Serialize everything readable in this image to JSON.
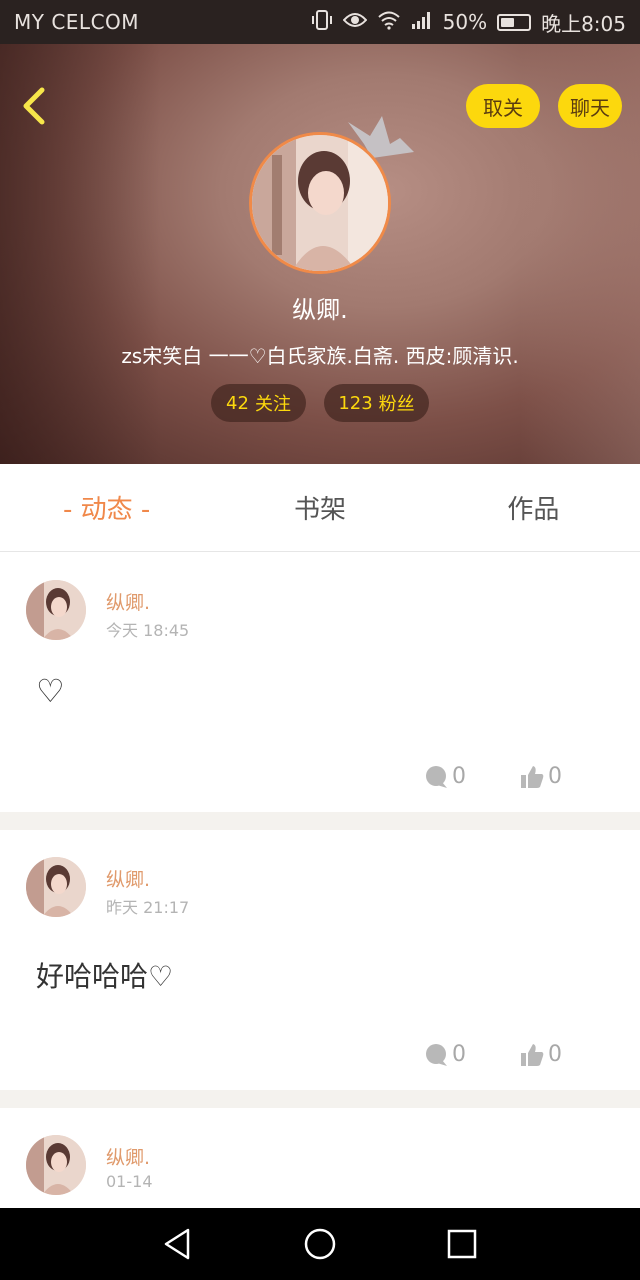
{
  "status_bar": {
    "carrier": "MY CELCOM",
    "battery_percent": "50%",
    "battery_level": 0.5,
    "time": "晚上8:05",
    "icons": [
      "vibrate-icon",
      "eye-icon",
      "wifi-icon",
      "signal-icon",
      "battery-icon"
    ]
  },
  "header": {
    "unfollow_label": "取关",
    "chat_label": "聊天",
    "nickname": "纵卿.",
    "signature": "zs宋笑白 一一♡白氏家族.白斋. 西皮:顾清识.",
    "follow_count": "42",
    "follow_label": "关注",
    "fans_count": "123",
    "fans_label": "粉丝",
    "colors": {
      "pill": "#fcd80d",
      "avatar_border": "#f08a48",
      "stat_text": "#fcd80d"
    }
  },
  "tabs": [
    {
      "label": "- 动态 -",
      "active": true
    },
    {
      "label": "书架",
      "active": false
    },
    {
      "label": "作品",
      "active": false
    }
  ],
  "posts": [
    {
      "author": "纵卿.",
      "time": "今天 18:45",
      "content": "♡",
      "comments": "0",
      "likes": "0"
    },
    {
      "author": "纵卿.",
      "time": "昨天 21:17",
      "content": "好哈哈哈♡",
      "comments": "0",
      "likes": "0"
    },
    {
      "author": "纵卿.",
      "time": "01-14"
    }
  ],
  "colors": {
    "accent": "#f0884a",
    "author": "#e09a6c",
    "muted": "#b4b4b4"
  }
}
